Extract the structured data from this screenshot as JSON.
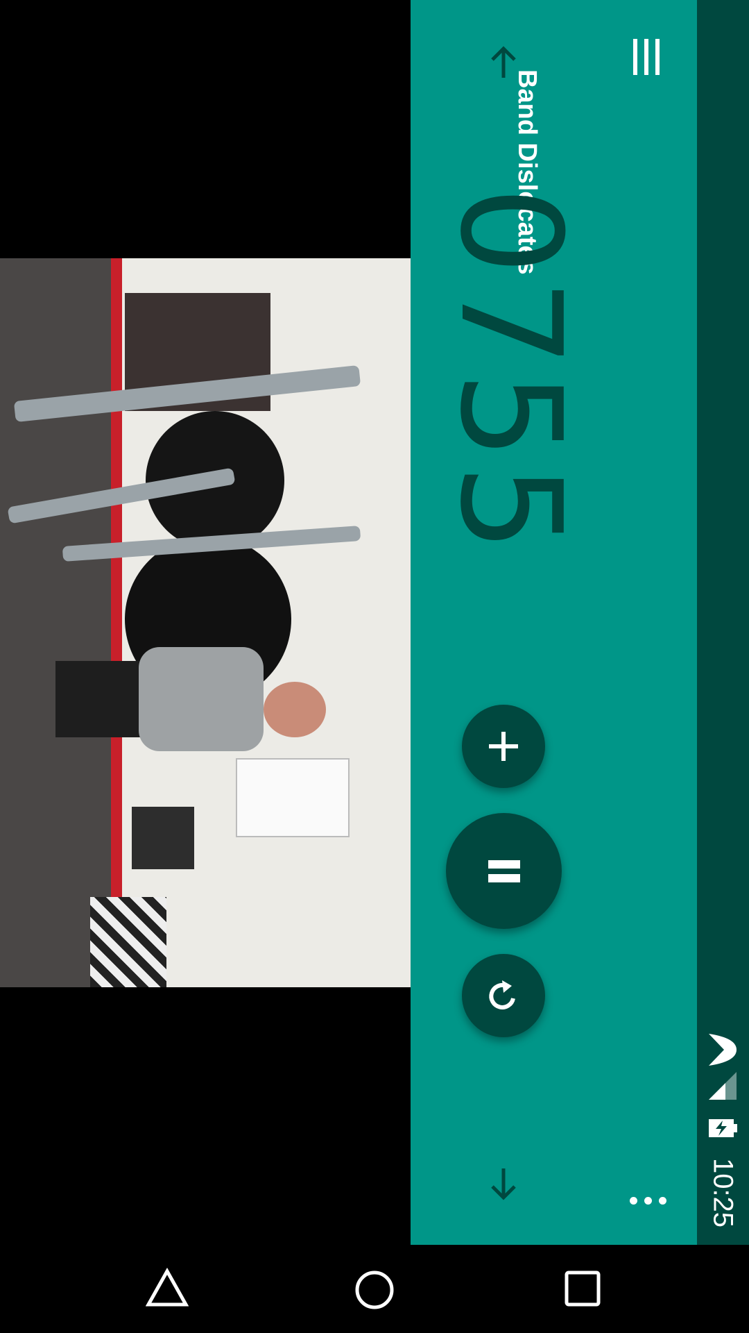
{
  "exercise": {
    "title": "Band Dislocates",
    "counter": "0755"
  },
  "status_bar": {
    "time": "10:25"
  },
  "icons": {
    "menu": "menu-icon",
    "up": "arrow-up-icon",
    "down": "arrow-down-icon",
    "more": "more-vertical-icon",
    "plus": "plus-icon",
    "pause": "pause-icon",
    "reset": "reset-icon",
    "battery": "battery-charging-icon",
    "signal": "cell-signal-icon",
    "wifi": "wifi-icon",
    "back": "back-icon",
    "home": "home-icon",
    "recents": "recents-icon"
  },
  "colors": {
    "panel": "#009688",
    "dark_teal": "#00483f",
    "text_light": "#ffffff"
  }
}
